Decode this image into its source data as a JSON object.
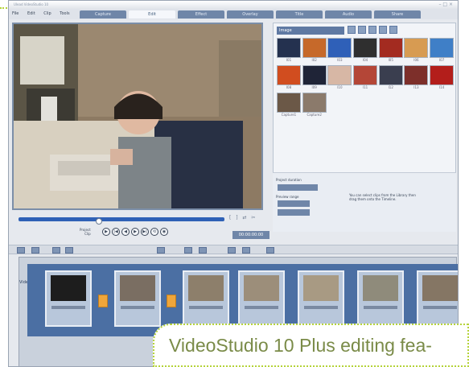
{
  "window": {
    "title": "Ulead VideoStudio 10",
    "controls": [
      "–",
      "□",
      "×"
    ]
  },
  "menu": [
    "File",
    "Edit",
    "Clip",
    "Tools"
  ],
  "tabs": [
    {
      "label": "Capture",
      "active": false
    },
    {
      "label": "Edit",
      "active": true
    },
    {
      "label": "Effect",
      "active": false
    },
    {
      "label": "Overlay",
      "active": false
    },
    {
      "label": "Title",
      "active": false
    },
    {
      "label": "Audio",
      "active": false
    },
    {
      "label": "Share",
      "active": false
    }
  ],
  "preview": {
    "mode_label_1": "Project",
    "mode_label_2": "Clip",
    "timecode": "00:00:00:00",
    "transport": [
      "▶",
      "|◀",
      "◀",
      "▶",
      "▶|",
      "⟲",
      "◉"
    ]
  },
  "library": {
    "selected_category": "Image",
    "thumbs": [
      {
        "label": "I01"
      },
      {
        "label": "I02"
      },
      {
        "label": "I03"
      },
      {
        "label": "I04"
      },
      {
        "label": "I05"
      },
      {
        "label": "I06"
      },
      {
        "label": "I07"
      },
      {
        "label": "I08"
      },
      {
        "label": "I09"
      },
      {
        "label": "I10"
      },
      {
        "label": "I11"
      },
      {
        "label": "I12"
      },
      {
        "label": "I13"
      },
      {
        "label": "I14"
      },
      {
        "label": "Capture1"
      },
      {
        "label": "Capture2"
      }
    ]
  },
  "properties": {
    "project_duration_label": "Project duration",
    "preview_range_label": "Preview range",
    "hint": "You can select clips from the Library then drag them onto the Timeline."
  },
  "timeline": {
    "track_label": "Video",
    "clips": [
      {
        "label": "00:00:03:00"
      },
      {
        "label": "00:00:03:00"
      },
      {
        "label": "00:00:03:00"
      },
      {
        "label": "00:00:03:00"
      },
      {
        "label": "00:00:03:00"
      },
      {
        "label": "00:00:03:00"
      },
      {
        "label": "00:00:03:00"
      }
    ]
  },
  "caption": {
    "text": "VideoStudio 10 Plus editing fea-"
  }
}
